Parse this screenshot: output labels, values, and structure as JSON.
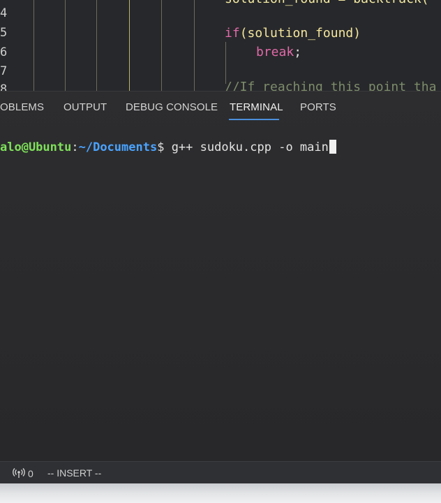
{
  "editor": {
    "line_numbers": [
      "4",
      "5",
      "6",
      "7",
      "8"
    ],
    "code_line_top": "solution_found = backtrack(",
    "if_keyword": "if",
    "if_condition": "(solution_found)",
    "break_keyword": "break",
    "break_semicolon": ";",
    "comment": "//If reaching this point tha"
  },
  "panel": {
    "tabs": [
      "OBLEMS",
      "OUTPUT",
      "DEBUG CONSOLE",
      "TERMINAL",
      "PORTS"
    ],
    "active_tab": "TERMINAL"
  },
  "terminal": {
    "user_host": "alo@Ubuntu",
    "colon": ":",
    "path": "~/Documents",
    "dollar": "$ ",
    "command": "g++ sudoku.cpp -o main"
  },
  "statusbar": {
    "port_count": "0",
    "mode": "-- INSERT --"
  },
  "colors": {
    "prompt_user": "#7ee05a",
    "prompt_path": "#4aa3ff",
    "keyword": "#e06aa9",
    "active_tab_underline": "#4c8fdc"
  },
  "icons": {
    "status_ports": "broadcast-icon"
  }
}
